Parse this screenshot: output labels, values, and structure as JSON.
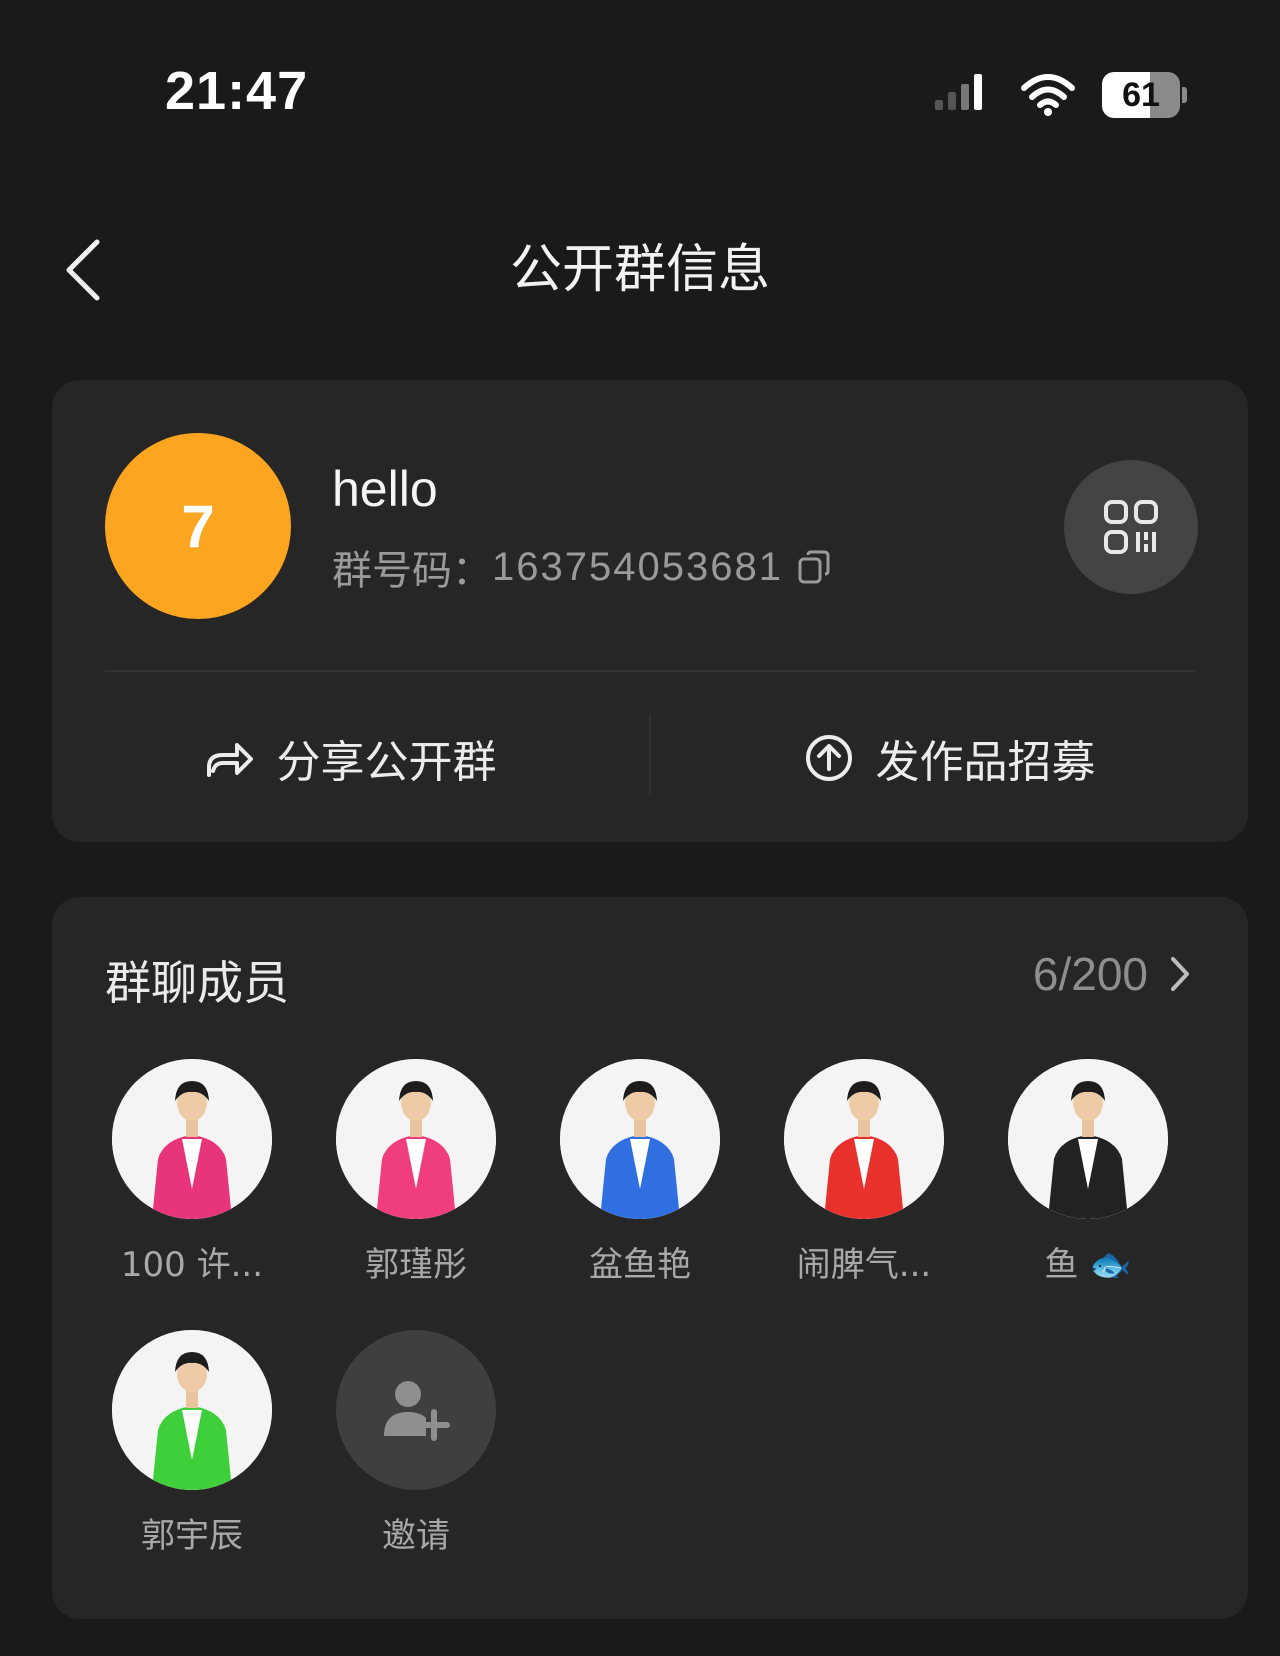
{
  "status_bar": {
    "time": "21:47",
    "battery_level": "61",
    "battery_fraction": 0.61,
    "icons": [
      "signal-icon",
      "wifi-icon",
      "battery-icon"
    ]
  },
  "nav": {
    "back_icon": "chevron-left-icon",
    "title": "公开群信息"
  },
  "group": {
    "avatar_text": "7",
    "avatar_color": "#fba521",
    "name": "hello",
    "id_label": "群号码：",
    "id_value": "163754053681",
    "copy_icon": "copy-icon",
    "qr_icon": "qr-code-icon"
  },
  "actions": {
    "share_label": "分享公开群",
    "share_icon": "share-arrow-icon",
    "publish_label": "发作品招募",
    "publish_icon": "upload-circle-icon"
  },
  "members": {
    "title": "群聊成员",
    "count": "6/200",
    "chevron_icon": "chevron-right-icon",
    "list": [
      {
        "name": "100 许...",
        "suit_color": "#e8357a"
      },
      {
        "name": "郭瑾彤",
        "suit_color": "#ef3d7e"
      },
      {
        "name": "盆鱼艳",
        "suit_color": "#2f6fe0"
      },
      {
        "name": "闹脾气...",
        "suit_color": "#e8312a"
      },
      {
        "name": "鱼",
        "suit_color": "#222222",
        "emoji": "🐟"
      },
      {
        "name": "郭宇辰",
        "suit_color": "#3fcf3a"
      }
    ],
    "invite_label": "邀请",
    "invite_icon": "add-user-icon"
  },
  "colors": {
    "background": "#1a1a1a",
    "card": "#262626"
  }
}
